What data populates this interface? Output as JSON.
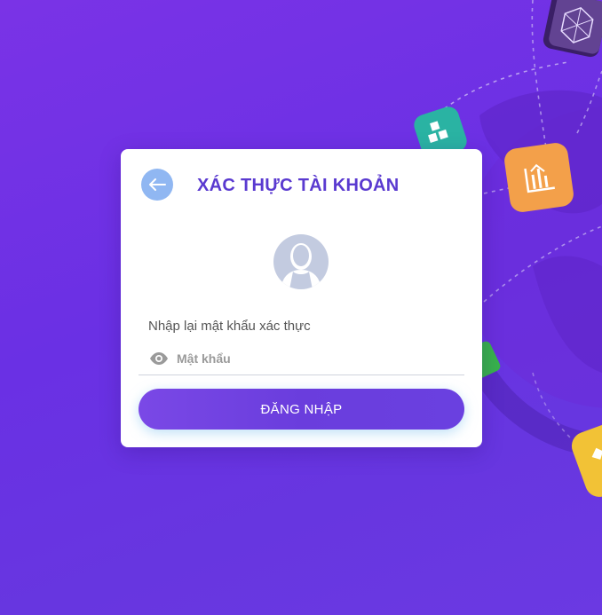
{
  "auth_card": {
    "title": "XÁC THỰC TÀI KHOẢN",
    "field_label": "Nhập lại mật khẩu xác thực",
    "password_placeholder": "Mật khẩu",
    "password_value": "",
    "login_button_label": "ĐĂNG NHẬP"
  },
  "icons": {
    "back": "arrow-left-icon",
    "avatar": "user-avatar-icon",
    "eye": "eye-icon"
  },
  "colors": {
    "background": "#6d34e3",
    "title": "#5a3ad0",
    "back_button": "#90b7f2",
    "button": "#6a3ddd",
    "avatar": "#c3cbe0"
  }
}
